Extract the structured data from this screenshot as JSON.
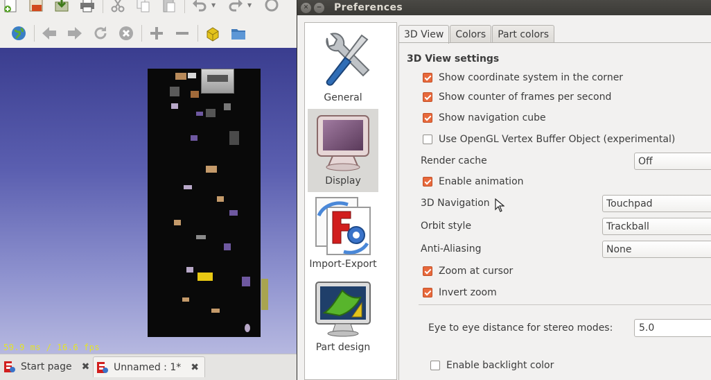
{
  "freecad": {
    "toolbar1": [
      {
        "icon": "new-document-icon"
      },
      {
        "icon": "open-document-icon"
      },
      {
        "icon": "save-document-icon"
      },
      {
        "icon": "print-icon"
      },
      {
        "icon": "cut-icon"
      },
      {
        "icon": "copy-icon"
      },
      {
        "icon": "paste-icon"
      },
      {
        "icon": "undo-icon"
      },
      {
        "icon": "redo-icon"
      },
      {
        "icon": "refresh-icon"
      }
    ],
    "toolbar2": [
      {
        "icon": "web-globe-icon"
      },
      {
        "icon": "back-arrow-icon"
      },
      {
        "icon": "forward-arrow-icon"
      },
      {
        "icon": "reload-icon"
      },
      {
        "icon": "stop-icon"
      },
      {
        "icon": "zoom-in-icon"
      },
      {
        "icon": "zoom-out-icon"
      },
      {
        "icon": "macro-icon"
      },
      {
        "icon": "folder-icon"
      }
    ],
    "fps_text": "59.9 ms / 16.6 fps",
    "doc_tabs": [
      {
        "label": "Start page",
        "active": false
      },
      {
        "label": "Unnamed : 1*",
        "active": true
      }
    ]
  },
  "dialog": {
    "title": "Preferences",
    "pages": [
      {
        "label": "General",
        "icon": "tools-wrench-screwdriver-icon",
        "selected": false
      },
      {
        "label": "Display",
        "icon": "monitor-icon",
        "selected": true
      },
      {
        "label": "Import-Export",
        "icon": "import-export-icon",
        "selected": false
      },
      {
        "label": "Part design",
        "icon": "part-design-icon",
        "selected": false
      }
    ],
    "tabs": [
      {
        "label": "3D View",
        "active": true
      },
      {
        "label": "Colors",
        "active": false
      },
      {
        "label": "Part colors",
        "active": false
      }
    ],
    "group_title": "3D View settings",
    "checkboxes": [
      {
        "label": "Show coordinate system in the corner",
        "checked": true
      },
      {
        "label": "Show counter of frames per second",
        "checked": true
      },
      {
        "label": "Show navigation cube",
        "checked": true
      },
      {
        "label": "Use OpenGL Vertex Buffer Object (experimental)",
        "checked": false
      }
    ],
    "render_cache": {
      "label": "Render cache",
      "value": "Off"
    },
    "enable_animation": {
      "label": "Enable animation",
      "checked": true
    },
    "navigation": {
      "label": "3D Navigation",
      "value": "Touchpad"
    },
    "orbit_style": {
      "label": "Orbit style",
      "value": "Trackball"
    },
    "anti_aliasing": {
      "label": "Anti-Aliasing",
      "value": "None"
    },
    "zoom_at_cursor": {
      "label": "Zoom at cursor",
      "checked": true
    },
    "invert_zoom": {
      "label": "Invert zoom",
      "checked": true
    },
    "eye_distance": {
      "label": "Eye to eye distance for stereo modes:",
      "value": "5.0"
    },
    "backlight": {
      "label": "Enable backlight color",
      "checked": false
    }
  },
  "colors": {
    "checkbox_accent": "#e8693c",
    "titlebar": "#3b3a36",
    "viewport_top": "#3a3d8f",
    "viewport_bottom": "#b6b8e0",
    "fps_text": "#e3e32a"
  }
}
